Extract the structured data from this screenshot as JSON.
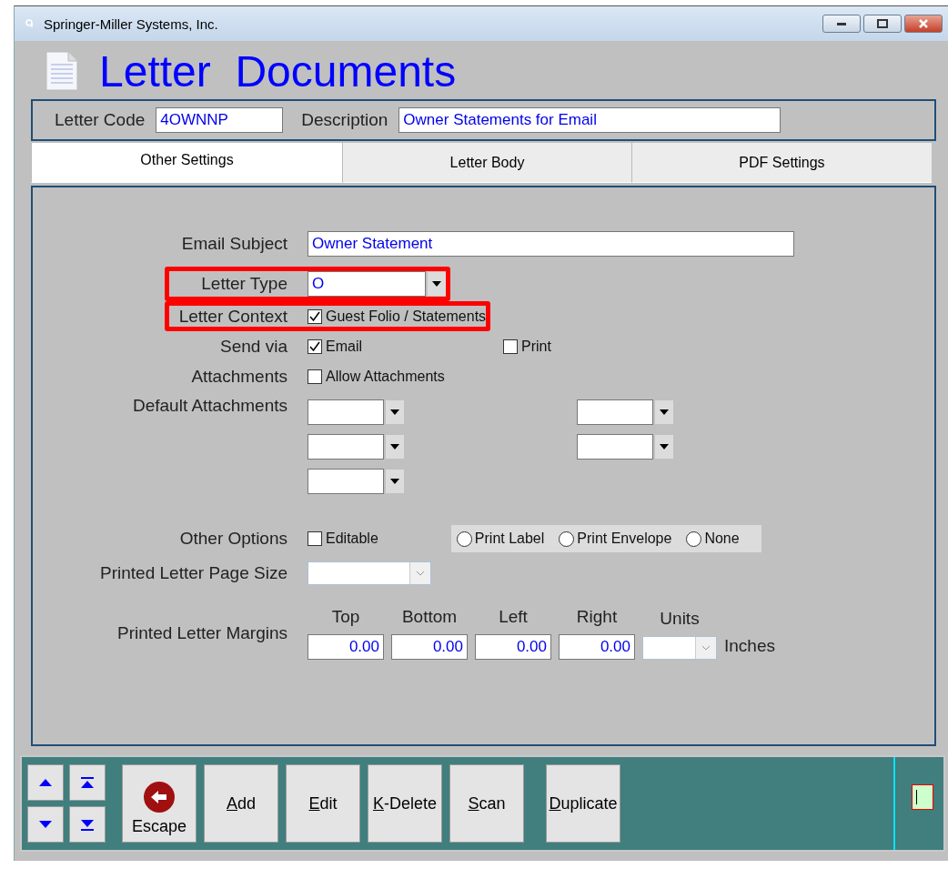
{
  "window": {
    "title": "Springer-Miller Systems, Inc."
  },
  "heading": "Letter  Documents",
  "header": {
    "fields": [
      {
        "label": "Letter Code",
        "value": "4OWNNP"
      },
      {
        "label": "Description",
        "value": "Owner Statements for Email"
      }
    ]
  },
  "tabs": [
    {
      "label": "Other Settings",
      "selected": true
    },
    {
      "label": "Letter Body",
      "selected": false
    },
    {
      "label": "PDF Settings",
      "selected": false
    }
  ],
  "form": {
    "rows": [
      {
        "kind": "text",
        "label": "Email Subject",
        "value": "Owner Statement",
        "highlighted": false
      },
      {
        "kind": "combo",
        "label": "Letter Type",
        "value": "O",
        "highlighted": true
      },
      {
        "kind": "checks",
        "label": "Letter Context",
        "highlighted": true,
        "checks": [
          {
            "label": "Guest Folio / Statements",
            "checked": true
          }
        ]
      },
      {
        "kind": "checks",
        "label": "Send via",
        "highlighted": false,
        "checks": [
          {
            "label": "Email",
            "checked": true
          },
          {
            "label": "Print",
            "checked": false
          }
        ]
      },
      {
        "kind": "checks",
        "label": "Attachments",
        "highlighted": false,
        "checks": [
          {
            "label": "Allow Attachments",
            "checked": false
          }
        ]
      },
      {
        "kind": "attachments",
        "label": "Default Attachments",
        "highlighted": false
      },
      {
        "kind": "options",
        "label": "Other Options",
        "highlighted": false,
        "checks": [
          {
            "label": "Editable",
            "checked": false
          }
        ],
        "radios": [
          {
            "label": "Print Label",
            "selected": false
          },
          {
            "label": "Print Envelope",
            "selected": false
          },
          {
            "label": "None",
            "selected": false
          }
        ]
      },
      {
        "kind": "disabled_combo",
        "label": "Printed Letter Page Size",
        "highlighted": false
      },
      {
        "kind": "margins",
        "label": "Printed Letter Margins",
        "highlighted": false,
        "fields": [
          {
            "heading": "Top",
            "value": "0.00"
          },
          {
            "heading": "Bottom",
            "value": "0.00"
          },
          {
            "heading": "Left",
            "value": "0.00"
          },
          {
            "heading": "Right",
            "value": "0.00"
          }
        ],
        "units_heading": "Units",
        "suffix": "Inches"
      }
    ]
  },
  "toolbar": {
    "buttons": [
      {
        "kind": "escape",
        "label": "Escape",
        "access_key": false
      },
      {
        "kind": "plain",
        "label": "Add",
        "access_key": true
      },
      {
        "kind": "plain",
        "label": "Edit",
        "access_key": true
      },
      {
        "kind": "plain",
        "label": "K-Delete",
        "access_key": true
      },
      {
        "kind": "plain",
        "label": "Scan",
        "access_key": true
      },
      {
        "kind": "plain",
        "label": "Duplicate",
        "access_key": true
      }
    ]
  }
}
